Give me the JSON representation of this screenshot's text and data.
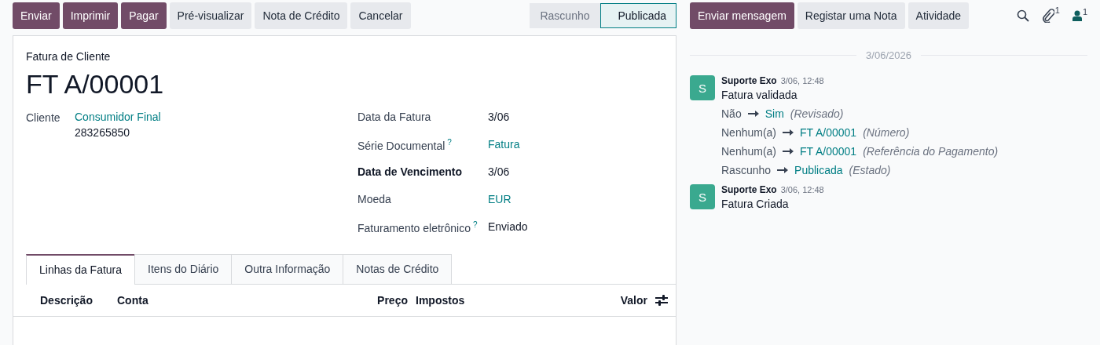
{
  "actions": [
    {
      "label": "Enviar",
      "kind": "primary"
    },
    {
      "label": "Imprimir",
      "kind": "primary"
    },
    {
      "label": "Pagar",
      "kind": "primary"
    },
    {
      "label": "Pré-visualizar",
      "kind": "secondary"
    },
    {
      "label": "Nota de Crédito",
      "kind": "secondary"
    },
    {
      "label": "Cancelar",
      "kind": "secondary"
    }
  ],
  "statusbar": [
    {
      "label": "Rascunho",
      "selected": false
    },
    {
      "label": "Publicada",
      "selected": true
    }
  ],
  "form": {
    "type_label": "Fatura de Cliente",
    "number": "FT A/00001",
    "left_fields": [
      {
        "label": "Cliente",
        "value": "Consumidor Final",
        "kind": "link",
        "detail": "283265850"
      }
    ],
    "right_fields": [
      {
        "label": "Data da Fatura",
        "value": "3/06",
        "kind": "text",
        "bold": false
      },
      {
        "label": "Série Documental",
        "help_mark": "?",
        "value": "Fatura",
        "kind": "link",
        "bold": false
      },
      {
        "label": "Data de Vencimento",
        "value": "3/06",
        "kind": "text",
        "bold": true
      },
      {
        "label": "Moeda",
        "value": "EUR",
        "kind": "link",
        "bold": false
      },
      {
        "label": "Faturamento eletrônico",
        "help_mark": "?",
        "value": "Enviado",
        "kind": "text",
        "bold": false
      }
    ]
  },
  "tabs": [
    {
      "label": "Linhas da Fatura",
      "selected": true
    },
    {
      "label": "Itens do Diário",
      "selected": false
    },
    {
      "label": "Outra Informação",
      "selected": false
    },
    {
      "label": "Notas de Crédito",
      "selected": false
    }
  ],
  "table": {
    "columns": [
      {
        "label": "Descrição",
        "kind": "text"
      },
      {
        "label": "Conta",
        "kind": "text"
      },
      {
        "label": "Preço",
        "kind": "number"
      },
      {
        "label": "Impostos",
        "kind": "text"
      },
      {
        "label": "Valor",
        "kind": "number"
      }
    ]
  },
  "chatter": {
    "buttons": [
      {
        "label": "Enviar mensagem",
        "kind": "primary"
      },
      {
        "label": "Registar uma Nota",
        "kind": "secondary"
      },
      {
        "label": "Atividade",
        "kind": "secondary"
      }
    ],
    "attachments_count": "1",
    "followers_count": "1",
    "date": "3/06/2026",
    "messages": [
      {
        "avatar": "S",
        "author": "Suporte Exo",
        "time": "3/06, 12:48",
        "body": "Fatura validada",
        "changes": [
          {
            "old": "Não",
            "new": "Sim",
            "field": "(Revisado)"
          },
          {
            "old": "Nenhum(a)",
            "new": "FT A/00001",
            "field": "(Número)"
          },
          {
            "old": "Nenhum(a)",
            "new": "FT A/00001",
            "field": "(Referência do Pagamento)"
          },
          {
            "old": "Rascunho",
            "new": "Publicada",
            "field": "(Estado)"
          }
        ]
      },
      {
        "avatar": "S",
        "author": "Suporte Exo",
        "time": "3/06, 12:48",
        "body": "Fatura Criada"
      }
    ]
  }
}
